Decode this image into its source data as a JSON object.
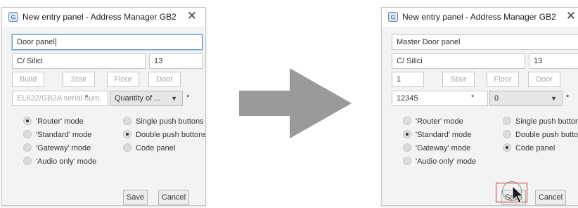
{
  "left_window": {
    "title": "New entry panel - Address Manager GB2",
    "close_label": "✕",
    "fields": {
      "name": "Door panel",
      "street": "C/ Silici",
      "number": "13",
      "build_placeholder": "Build",
      "stair_placeholder": "Stair",
      "floor_placeholder": "Floor",
      "door_placeholder": "Door",
      "serial_placeholder": "EL632/GB2A serial num.",
      "serial_required": "*",
      "quantity_select": "Quantity of ...",
      "quantity_required": "*"
    },
    "modes": [
      {
        "label": "'Router' mode",
        "selected": true
      },
      {
        "label": "'Standard' mode",
        "selected": false
      },
      {
        "label": "'Gateway' mode",
        "selected": false
      },
      {
        "label": "'Audio only' mode",
        "selected": false
      }
    ],
    "buttons_type": [
      {
        "label": "Single push buttons",
        "selected": false
      },
      {
        "label": "Double push buttons",
        "selected": true
      },
      {
        "label": "Code panel",
        "selected": false
      }
    ],
    "save_label": "Save",
    "cancel_label": "Cancel"
  },
  "right_window": {
    "title": "New entry panel - Address Manager GB2",
    "close_label": "✕",
    "fields": {
      "name": "Master Door panel",
      "street": "C/ Silici",
      "number": "13",
      "build": "1",
      "stair_placeholder": "Stair",
      "floor_placeholder": "Floor",
      "door_placeholder": "Door",
      "serial": "12345",
      "serial_required": "*",
      "quantity_select": "0",
      "quantity_required": "*"
    },
    "modes": [
      {
        "label": "'Router' mode",
        "selected": false
      },
      {
        "label": "'Standard' mode",
        "selected": true
      },
      {
        "label": "'Gateway' mode",
        "selected": false
      },
      {
        "label": "'Audio only' mode",
        "selected": false
      }
    ],
    "buttons_type": [
      {
        "label": "Single push buttons",
        "selected": false
      },
      {
        "label": "Double push buttons",
        "selected": false
      },
      {
        "label": "Code panel",
        "selected": true
      }
    ],
    "save_label": "Save",
    "cancel_label": "Cancel"
  },
  "icons": {
    "app": "app-icon",
    "dropdown": "chevron-down-icon",
    "arrow": "right-arrow-icon",
    "cursor": "mouse-pointer-icon"
  },
  "colors": {
    "highlight": "#d93030",
    "arrow": "#9a9a9a",
    "panel_bg": "#f3f3f3",
    "focus_border": "#6fa0d0"
  }
}
